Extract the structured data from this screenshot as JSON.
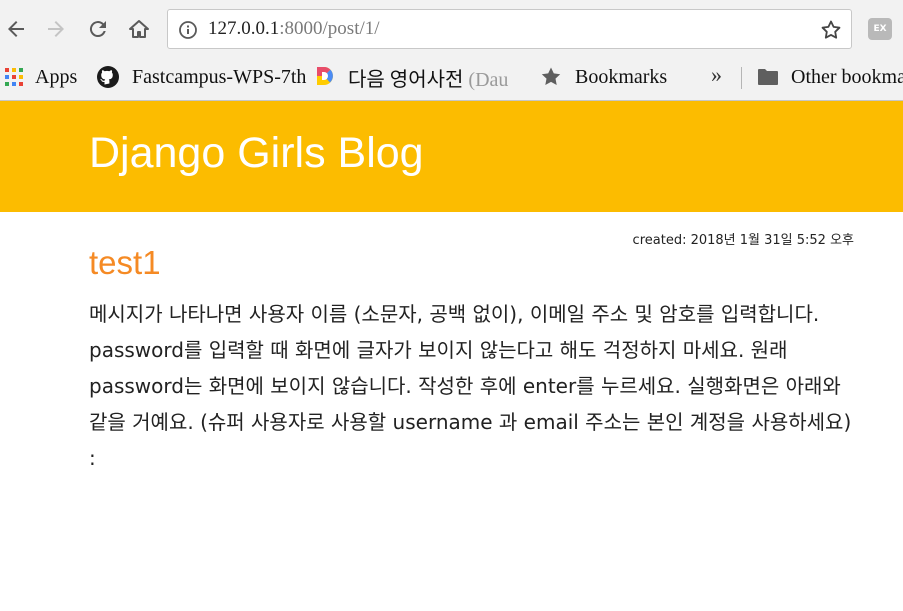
{
  "browser": {
    "url": {
      "host": "127.0.0.1",
      "rest": ":8000/post/1/"
    },
    "extension_badge": "EX",
    "bookmarks": [
      {
        "label": "Apps",
        "icon": "apps-grid-icon"
      },
      {
        "label": "Fastcampus-WPS-7th",
        "icon": "github-icon"
      },
      {
        "label": "다음 영어사전 ",
        "label_faded": "(Dau",
        "icon": "daum-logo-icon"
      },
      {
        "label": "Bookmarks",
        "icon": "star-icon"
      },
      {
        "label": "Other bookmarks",
        "icon": "folder-icon"
      }
    ],
    "overflow_chevron": "»"
  },
  "page": {
    "site_title": "Django Girls Blog",
    "post": {
      "date": "created: 2018년 1월 31일 5:52 오후",
      "title": "test1",
      "body": "메시지가 나타나면 사용자 이름 (소문자, 공백 없이), 이메일 주소 및 암호를 입력합니다. password를 입력할 때 화면에 글자가 보이지 않는다고 해도 걱정하지 마세요. 원래 password는 화면에 보이지 않습니다. 작성한 후에 enter를 누르세요. 실행화면은 아래와 같을 거예요. (슈퍼 사용자로 사용할 username 과 email 주소는 본인 계정을 사용하세요) :"
    }
  },
  "colors": {
    "header_bg": "#fcbc00",
    "post_title": "#f58a24",
    "chrome_bg": "#f2f2f2"
  }
}
